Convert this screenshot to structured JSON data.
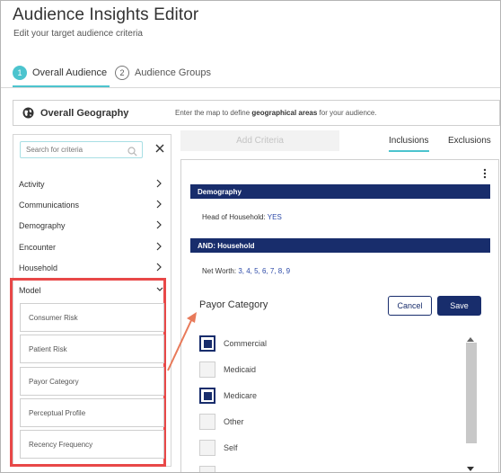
{
  "header": {
    "title": "Audience Insights Editor",
    "subtitle": "Edit your target audience criteria"
  },
  "steps": [
    {
      "number": "1",
      "label": "Overall Audience",
      "active": true
    },
    {
      "number": "2",
      "label": "Audience Groups",
      "active": false
    }
  ],
  "geography": {
    "icon": "globe-icon",
    "title": "Overall Geography",
    "desc_pre": "Enter the map to define ",
    "desc_bold": "geographical areas",
    "desc_post": " for your audience."
  },
  "search": {
    "placeholder": "Search for criteria"
  },
  "categories": [
    "Activity",
    "Communications",
    "Demography",
    "Encounter",
    "Household",
    "Model"
  ],
  "model_subcategories": [
    "Consumer Risk",
    "Patient Risk",
    "Payor Category",
    "Perceptual Profile",
    "Recency Frequency"
  ],
  "add_criteria_label": "Add Criteria",
  "tabs": {
    "inclusions": "Inclusions",
    "exclusions": "Exclusions",
    "active": "inclusions"
  },
  "sections": [
    {
      "header": "Demography",
      "label": "Head of Household: ",
      "value": "YES"
    },
    {
      "header": "AND: Household",
      "label": "Net Worth: ",
      "value": "3, 4, 5, 6, 7, 8, 9"
    }
  ],
  "payor": {
    "title": "Payor Category",
    "cancel_label": "Cancel",
    "save_label": "Save",
    "options": [
      {
        "label": "Commercial",
        "checked": true
      },
      {
        "label": "Medicaid",
        "checked": false
      },
      {
        "label": "Medicare",
        "checked": true
      },
      {
        "label": "Other",
        "checked": false
      },
      {
        "label": "Self",
        "checked": false
      }
    ]
  },
  "colors": {
    "accent": "#4cc4ce",
    "navy": "#182d6c",
    "highlight": "#e84848"
  }
}
